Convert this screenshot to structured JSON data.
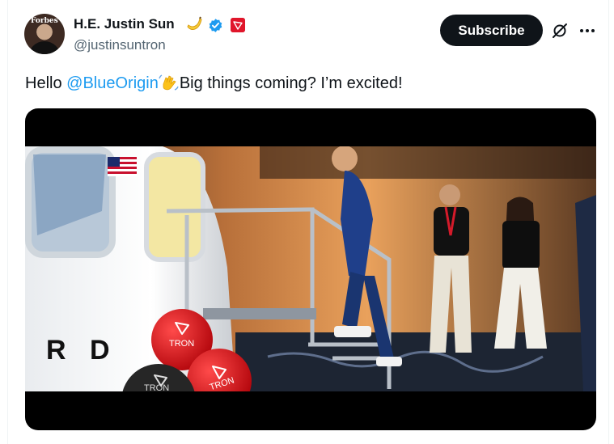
{
  "user": {
    "display_name": "H.E. Justin Sun",
    "handle": "@justinsuntron",
    "avatar_text": "Forbes"
  },
  "actions": {
    "subscribe_label": "Subscribe"
  },
  "tweet": {
    "text_before": "Hello ",
    "mention": "@BlueOrigin",
    "text_after": "Big things coming? I’m excited!"
  },
  "media": {
    "capsule_text": "R D",
    "balloon_label": "TRON"
  },
  "colors": {
    "link": "#1d9bf0",
    "verified": "#1d9bf0",
    "tron_red": "#e0162b",
    "button_bg": "#0f1419",
    "secondary_text": "#536471"
  },
  "icons": [
    "banana-icon",
    "verified-icon",
    "tron-badge-icon",
    "grok-icon",
    "more-icon",
    "waving-hand-icon"
  ]
}
